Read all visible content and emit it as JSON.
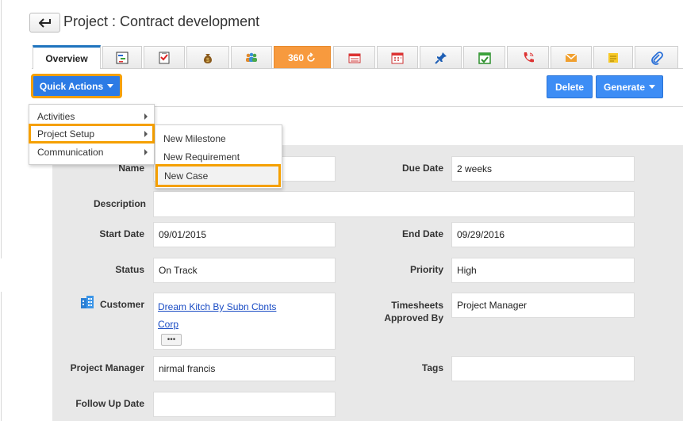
{
  "header": {
    "title": "Project : Contract development",
    "back_icon": "back-arrow-icon"
  },
  "tabs": [
    {
      "label": "Overview",
      "icon": ""
    },
    {
      "label": "",
      "icon": "gantt-icon"
    },
    {
      "label": "",
      "icon": "task-list-icon"
    },
    {
      "label": "",
      "icon": "money-bag-icon"
    },
    {
      "label": "",
      "icon": "team-icon"
    },
    {
      "label": "360",
      "icon": "refresh-icon"
    },
    {
      "label": "",
      "icon": "list-icon"
    },
    {
      "label": "",
      "icon": "calendar-icon"
    },
    {
      "label": "",
      "icon": "pin-icon"
    },
    {
      "label": "",
      "icon": "calendar-check-icon"
    },
    {
      "label": "",
      "icon": "phone-icon"
    },
    {
      "label": "",
      "icon": "mail-icon"
    },
    {
      "label": "",
      "icon": "note-icon"
    },
    {
      "label": "",
      "icon": "paperclip-icon"
    }
  ],
  "toolbar": {
    "quick_actions": "Quick Actions",
    "delete": "Delete",
    "generate": "Generate"
  },
  "quick_menu": {
    "items": [
      "Activities",
      "Project Setup",
      "Communication"
    ],
    "highlighted": "Project Setup",
    "submenu": [
      "New Milestone",
      "New Requirement",
      "New Case"
    ],
    "submenu_highlighted": "New Case"
  },
  "form": {
    "name_label": "Name",
    "name_value": "",
    "due_date_label": "Due Date",
    "due_date_value": "2 weeks",
    "description_label": "Description",
    "description_value": "",
    "start_date_label": "Start Date",
    "start_date_value": "09/01/2015",
    "end_date_label": "End Date",
    "end_date_value": "09/29/2016",
    "status_label": "Status",
    "status_value": "On Track",
    "priority_label": "Priority",
    "priority_value": "High",
    "customer_label": "Customer",
    "customer_line1": "Dream Kitch By Subn Cbnts",
    "customer_line2": "Corp",
    "timesheets_label_1": "Timesheets",
    "timesheets_label_2": "Approved By",
    "timesheets_value": "Project Manager",
    "pm_label": "Project Manager",
    "pm_value": "nirmal francis",
    "tags_label": "Tags",
    "tags_value": "",
    "follow_up_label": "Follow Up Date",
    "follow_up_value": "",
    "more_button": "•••"
  },
  "colors": {
    "accent": "#2c7be5",
    "highlight": "#f5a000",
    "tab_360": "#f79a3e"
  }
}
